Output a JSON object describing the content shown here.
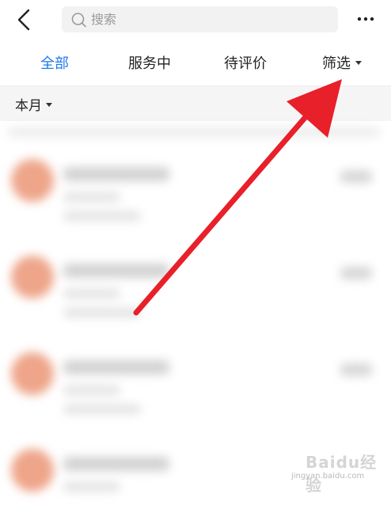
{
  "header": {
    "search_placeholder": "搜索",
    "back_icon": "chevron-left-icon",
    "search_icon": "search-icon",
    "more_icon": "more-horizontal-icon"
  },
  "tabs": [
    {
      "label": "全部",
      "active": true
    },
    {
      "label": "服务中",
      "active": false
    },
    {
      "label": "待评价",
      "active": false
    },
    {
      "label": "筛选",
      "active": false,
      "dropdown": true
    }
  ],
  "filter": {
    "month_label": "本月"
  },
  "colors": {
    "accent": "#1f7bea",
    "arrow": "#e8202a",
    "avatar": "#eea58a",
    "search_bg": "#f2f2f2",
    "section_bg": "#f5f5f5"
  },
  "watermark": {
    "text": "Baidu经验",
    "sub": "jingyan.baidu.com"
  }
}
